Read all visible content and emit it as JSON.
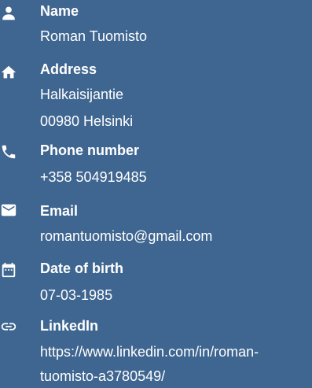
{
  "colors": {
    "background": "#3f6690",
    "text": "#ffffff"
  },
  "items": [
    {
      "icon": "person-icon",
      "label": "Name",
      "lines": [
        "Roman Tuomisto"
      ]
    },
    {
      "icon": "home-icon",
      "label": "Address",
      "lines": [
        "Halkaisijantie",
        "00980 Helsinki"
      ]
    },
    {
      "icon": "phone-icon",
      "label": "Phone number",
      "lines": [
        "+358 504919485"
      ]
    },
    {
      "icon": "email-icon",
      "label": "Email",
      "lines": [
        "romantuomisto@gmail.com"
      ]
    },
    {
      "icon": "calendar-icon",
      "label": "Date of birth",
      "lines": [
        "07-03-1985"
      ]
    },
    {
      "icon": "link-icon",
      "label": "LinkedIn",
      "lines": [
        "https://www.linkedin.com/in/roman-",
        "tuomisto-a3780549/"
      ]
    }
  ]
}
